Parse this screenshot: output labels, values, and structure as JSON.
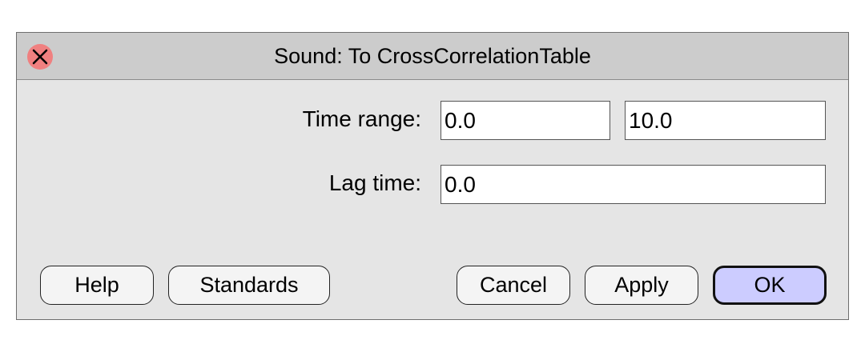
{
  "window": {
    "title": "Sound: To CrossCorrelationTable",
    "close_icon": "close-icon"
  },
  "form": {
    "time_range": {
      "label": "Time range:",
      "from_value": "0.0",
      "to_value": "10.0"
    },
    "lag_time": {
      "label": "Lag time:",
      "value": "0.0"
    }
  },
  "buttons": {
    "help": "Help",
    "standards": "Standards",
    "cancel": "Cancel",
    "apply": "Apply",
    "ok": "OK"
  },
  "colors": {
    "titlebar": "#cccccc",
    "body": "#e5e5e5",
    "close_button": "#f08080",
    "ok_button": "#ccccff"
  }
}
